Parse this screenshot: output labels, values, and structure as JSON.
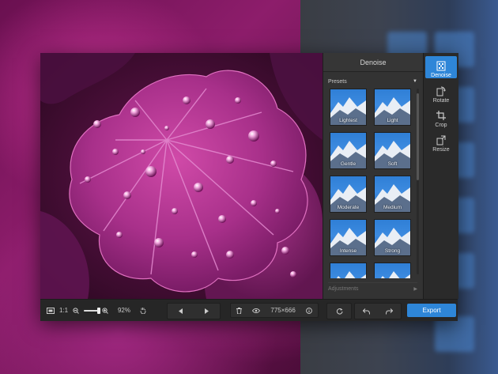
{
  "panel": {
    "title": "Denoise",
    "presets_label": "Presets",
    "adjustments_label": "Adjustments",
    "presets": [
      {
        "label": "Lightest"
      },
      {
        "label": "Light"
      },
      {
        "label": "Gentle"
      },
      {
        "label": "Soft"
      },
      {
        "label": "Moderate"
      },
      {
        "label": "Medium"
      },
      {
        "label": "Intense"
      },
      {
        "label": "Strong"
      },
      {
        "label": ""
      },
      {
        "label": ""
      }
    ]
  },
  "tools": [
    {
      "label": "Denoise",
      "icon": "denoise-icon",
      "active": true
    },
    {
      "label": "Rotate",
      "icon": "rotate-icon",
      "active": false
    },
    {
      "label": "Crop",
      "icon": "crop-icon",
      "active": false
    },
    {
      "label": "Resize",
      "icon": "resize-icon",
      "active": false
    }
  ],
  "bottom_bar": {
    "actual_size_label": "1:1",
    "zoom_percent": "92%",
    "zoom_level": 0.55,
    "dimensions": "775×666",
    "export_label": "Export"
  },
  "colors": {
    "accent": "#2e86d8",
    "panel_bg": "#333333",
    "leaf": "#b03a95"
  }
}
